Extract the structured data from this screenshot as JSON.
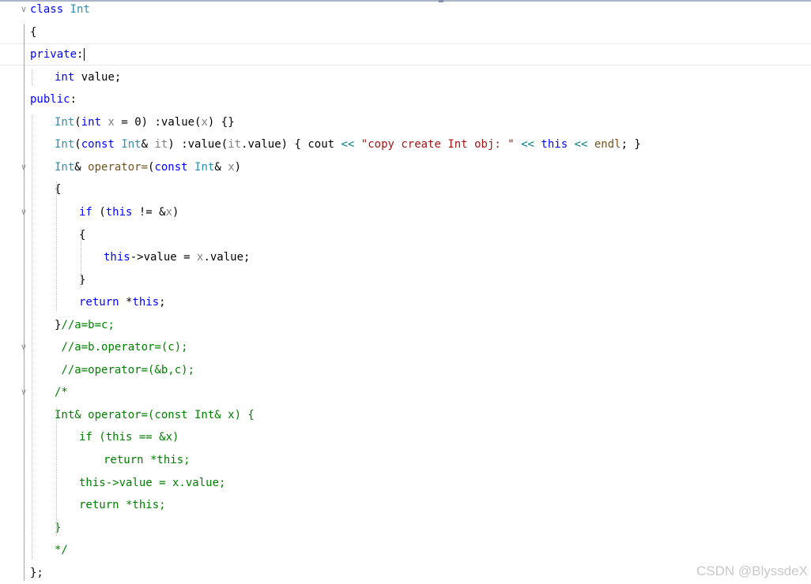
{
  "editor": {
    "lines": [
      {
        "fold": "∨",
        "indent": 0,
        "tokens": [
          {
            "t": "class",
            "c": "kw"
          },
          {
            "t": " "
          },
          {
            "t": "Int",
            "c": "ty"
          }
        ]
      },
      {
        "fold": "",
        "indent": 0,
        "tokens": [
          {
            "t": "{"
          }
        ]
      },
      {
        "fold": "",
        "indent": 0,
        "current": true,
        "caret": true,
        "tokens": [
          {
            "t": "private",
            "c": "kw"
          },
          {
            "t": ":"
          }
        ]
      },
      {
        "fold": "",
        "indent": 1,
        "tokens": [
          {
            "t": "int",
            "c": "kw"
          },
          {
            "t": " value;"
          }
        ]
      },
      {
        "fold": "",
        "indent": 0,
        "tokens": [
          {
            "t": "public",
            "c": "kw"
          },
          {
            "t": ":"
          }
        ]
      },
      {
        "fold": "",
        "indent": 1,
        "tokens": [
          {
            "t": "Int",
            "c": "ty"
          },
          {
            "t": "("
          },
          {
            "t": "int",
            "c": "kw"
          },
          {
            "t": " "
          },
          {
            "t": "x",
            "c": "par"
          },
          {
            "t": " = 0) :value("
          },
          {
            "t": "x",
            "c": "par"
          },
          {
            "t": ") {}"
          }
        ]
      },
      {
        "fold": "",
        "indent": 1,
        "tokens": [
          {
            "t": "Int",
            "c": "ty"
          },
          {
            "t": "("
          },
          {
            "t": "const",
            "c": "kw"
          },
          {
            "t": " "
          },
          {
            "t": "Int",
            "c": "ty"
          },
          {
            "t": "& "
          },
          {
            "t": "it",
            "c": "par"
          },
          {
            "t": ") :value("
          },
          {
            "t": "it",
            "c": "par"
          },
          {
            "t": ".value) { cout "
          },
          {
            "t": "<<",
            "c": "op"
          },
          {
            "t": " "
          },
          {
            "t": "\"copy create Int obj: \"",
            "c": "str"
          },
          {
            "t": " "
          },
          {
            "t": "<<",
            "c": "op"
          },
          {
            "t": " "
          },
          {
            "t": "this",
            "c": "kw"
          },
          {
            "t": " "
          },
          {
            "t": "<<",
            "c": "op"
          },
          {
            "t": " "
          },
          {
            "t": "endl",
            "c": "fn"
          },
          {
            "t": "; }"
          }
        ]
      },
      {
        "fold": "∨",
        "indent": 1,
        "tokens": [
          {
            "t": "Int",
            "c": "ty"
          },
          {
            "t": "& "
          },
          {
            "t": "operator=",
            "c": "fn"
          },
          {
            "t": "("
          },
          {
            "t": "const",
            "c": "kw"
          },
          {
            "t": " "
          },
          {
            "t": "Int",
            "c": "ty"
          },
          {
            "t": "& "
          },
          {
            "t": "x",
            "c": "par"
          },
          {
            "t": ")"
          }
        ]
      },
      {
        "fold": "",
        "indent": 1,
        "tokens": [
          {
            "t": "{"
          }
        ]
      },
      {
        "fold": "∨",
        "indent": 2,
        "tokens": [
          {
            "t": "if",
            "c": "kw"
          },
          {
            "t": " ("
          },
          {
            "t": "this",
            "c": "kw"
          },
          {
            "t": " != &"
          },
          {
            "t": "x",
            "c": "par"
          },
          {
            "t": ")"
          }
        ]
      },
      {
        "fold": "",
        "indent": 2,
        "tokens": [
          {
            "t": "{"
          }
        ]
      },
      {
        "fold": "",
        "indent": 3,
        "tokens": [
          {
            "t": "this",
            "c": "kw"
          },
          {
            "t": "->value = "
          },
          {
            "t": "x",
            "c": "par"
          },
          {
            "t": ".value;"
          }
        ]
      },
      {
        "fold": "",
        "indent": 2,
        "tokens": [
          {
            "t": "}"
          }
        ]
      },
      {
        "fold": "",
        "indent": 2,
        "tokens": [
          {
            "t": "return",
            "c": "kw"
          },
          {
            "t": " *"
          },
          {
            "t": "this",
            "c": "kw"
          },
          {
            "t": ";"
          }
        ]
      },
      {
        "fold": "",
        "indent": 1,
        "tokens": [
          {
            "t": "}"
          },
          {
            "t": "//a=b=c;",
            "c": "cm"
          }
        ]
      },
      {
        "fold": "∨",
        "indent": 1,
        "pad": " ",
        "tokens": [
          {
            "t": "//a=b.operator=(c);",
            "c": "cm"
          }
        ]
      },
      {
        "fold": "",
        "indent": 1,
        "pad": " ",
        "tokens": [
          {
            "t": "//a=operator=(&b,c);",
            "c": "cm"
          }
        ]
      },
      {
        "fold": "∨",
        "indent": 1,
        "tokens": [
          {
            "t": "/*",
            "c": "cm"
          }
        ]
      },
      {
        "fold": "",
        "indent": 1,
        "tokens": [
          {
            "t": "Int& operator=(const Int& x) {",
            "c": "cm"
          }
        ]
      },
      {
        "fold": "",
        "indent": 2,
        "tokens": [
          {
            "t": "if (this == &x)",
            "c": "cm"
          }
        ]
      },
      {
        "fold": "",
        "indent": 3,
        "tokens": [
          {
            "t": "return *this;",
            "c": "cm"
          }
        ]
      },
      {
        "fold": "",
        "indent": 2,
        "tokens": [
          {
            "t": "this->value = x.value;",
            "c": "cm"
          }
        ]
      },
      {
        "fold": "",
        "indent": 2,
        "tokens": [
          {
            "t": "return *this;",
            "c": "cm"
          }
        ]
      },
      {
        "fold": "",
        "indent": 1,
        "tokens": [
          {
            "t": "}",
            "c": "cm"
          }
        ]
      },
      {
        "fold": "",
        "indent": 1,
        "tokens": [
          {
            "t": "*/",
            "c": "cm"
          }
        ]
      },
      {
        "fold": "",
        "indent": 0,
        "tokens": [
          {
            "t": "};"
          }
        ]
      }
    ]
  },
  "watermark": {
    "text": "CSDN @BlyssdeX"
  }
}
